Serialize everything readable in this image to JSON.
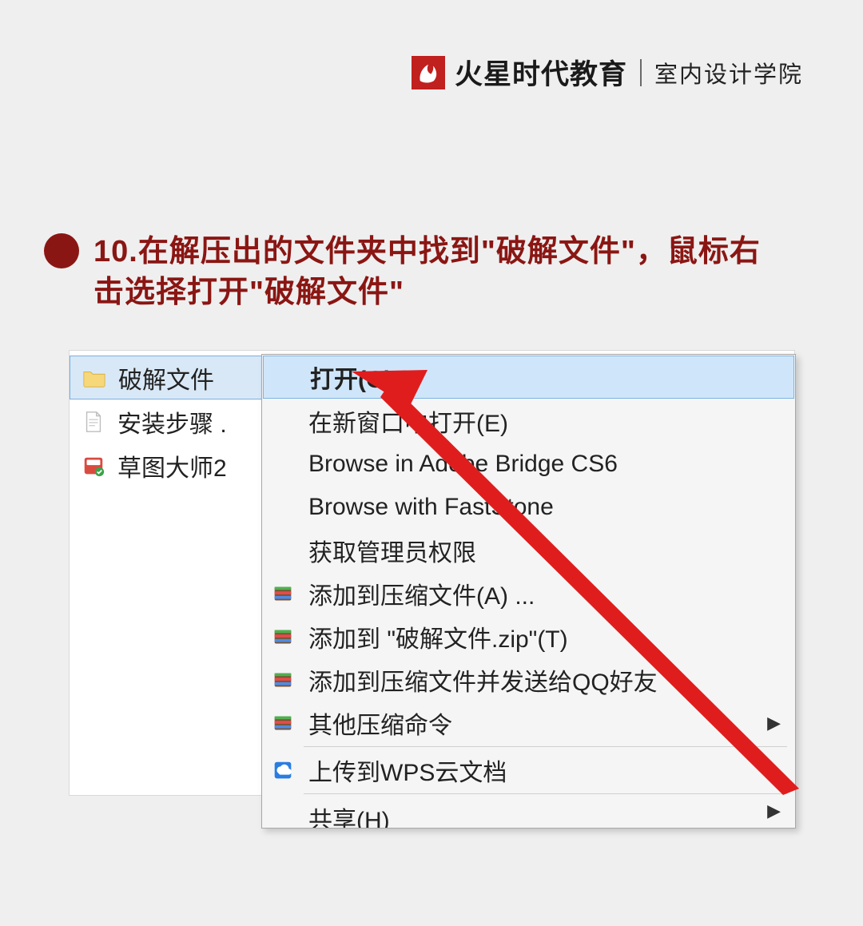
{
  "header": {
    "brand_main": "火星时代教育",
    "brand_sub": "室内设计学院"
  },
  "step": {
    "number_label": "10.",
    "text": "在解压出的文件夹中找到\"破解文件\"，鼠标右击选择打开\"破解文件\""
  },
  "files": [
    {
      "name": "破解文件",
      "icon": "folder",
      "selected": true
    },
    {
      "name": "安装步骤 .",
      "icon": "doc",
      "selected": false
    },
    {
      "name": "草图大师2",
      "icon": "exe",
      "selected": false
    }
  ],
  "context_menu": {
    "items": [
      {
        "label": "打开(O)",
        "icon": "",
        "highlight": true,
        "submenu": false
      },
      {
        "label": "在新窗口中打开(E)",
        "icon": "",
        "submenu": false
      },
      {
        "label": "Browse in Adobe Bridge CS6",
        "icon": "",
        "submenu": false
      },
      {
        "label": "Browse with FastStone",
        "icon": "",
        "submenu": false
      },
      {
        "label": "获取管理员权限",
        "icon": "",
        "submenu": false
      },
      {
        "label": "添加到压缩文件(A) ...",
        "icon": "zip",
        "submenu": false
      },
      {
        "label": "添加到 \"破解文件.zip\"(T)",
        "icon": "zip",
        "submenu": false
      },
      {
        "label": "添加到压缩文件并发送给QQ好友",
        "icon": "zip",
        "submenu": false
      },
      {
        "label": "其他压缩命令",
        "icon": "zip",
        "submenu": true
      },
      {
        "separator": true
      },
      {
        "label": "上传到WPS云文档",
        "icon": "cloud",
        "submenu": false
      },
      {
        "separator": true
      },
      {
        "label": "共享(H)",
        "icon": "",
        "submenu": true,
        "cut": true
      }
    ]
  }
}
